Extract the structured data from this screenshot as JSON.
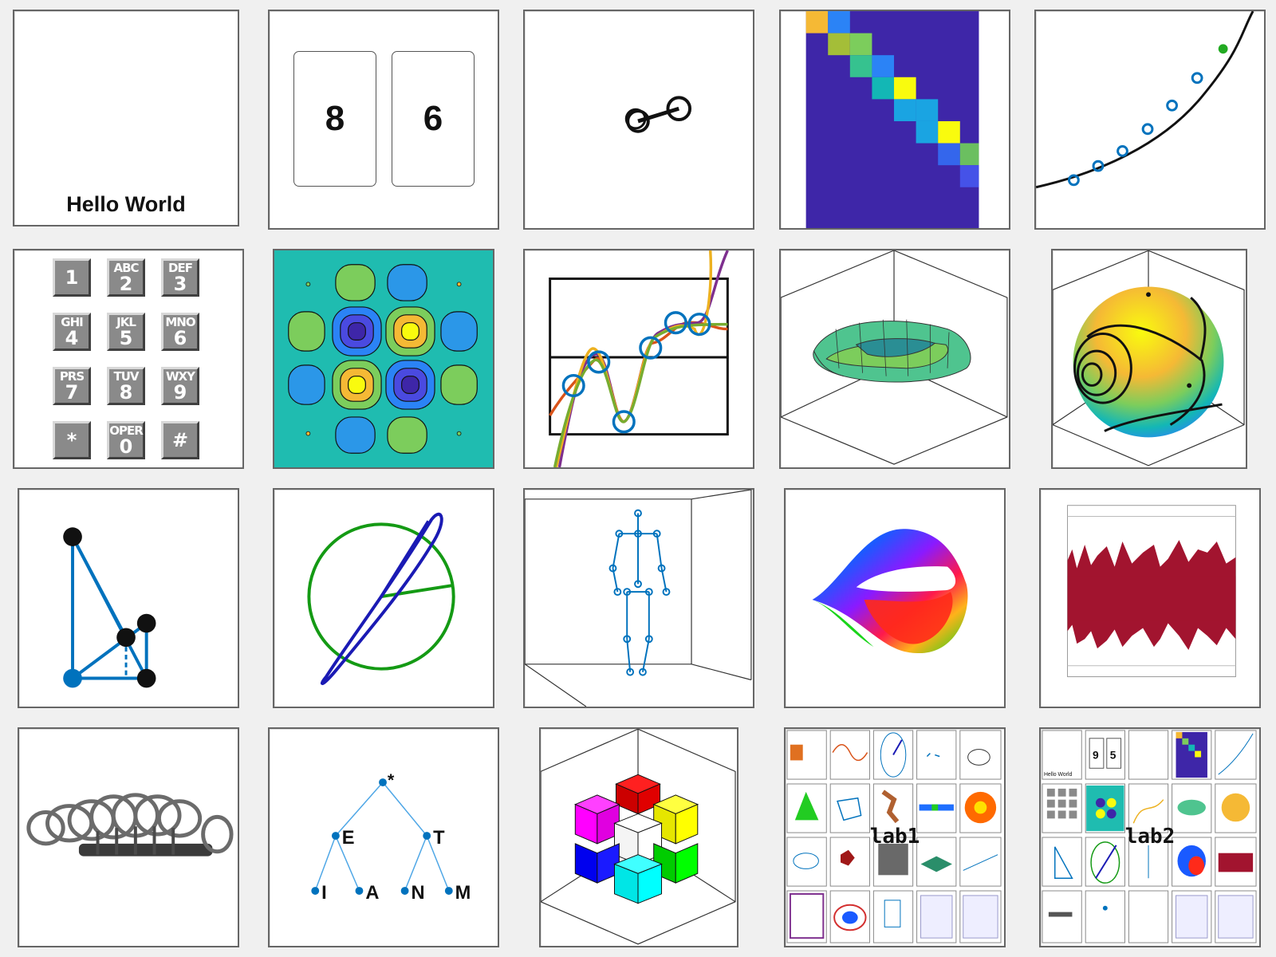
{
  "hello_world": {
    "text": "Hello World"
  },
  "cards": [
    "8",
    "6"
  ],
  "keypad": [
    {
      "sub": "",
      "main": "1"
    },
    {
      "sub": "ABC",
      "main": "2"
    },
    {
      "sub": "DEF",
      "main": "3"
    },
    {
      "sub": "GHI",
      "main": "4"
    },
    {
      "sub": "JKL",
      "main": "5"
    },
    {
      "sub": "MNO",
      "main": "6"
    },
    {
      "sub": "PRS",
      "main": "7"
    },
    {
      "sub": "TUV",
      "main": "8"
    },
    {
      "sub": "WXY",
      "main": "9"
    },
    {
      "sub": "",
      "main": "*"
    },
    {
      "sub": "OPER",
      "main": "0"
    },
    {
      "sub": "",
      "main": "#"
    }
  ],
  "morse_tree": {
    "root": "*",
    "level1": [
      "E",
      "T"
    ],
    "level2": [
      "I",
      "A",
      "N",
      "M"
    ]
  },
  "lab_thumbnails": {
    "lab1_label": "lab1",
    "lab2_label": "lab2",
    "lab2_cards": [
      "9",
      "5"
    ],
    "lab2_hello": "Hello World"
  },
  "colors": {
    "background": "#f0f0f0",
    "tile_border": "#666666",
    "parula_blue": "#3e26a8",
    "parula_yellow": "#f9fb0e",
    "plot_blue": "#0072bd",
    "plot_orange": "#d95319",
    "plot_yellow": "#edb120",
    "plot_purple": "#7e2f8e",
    "plot_green": "#77ac30",
    "audio_red": "#a2142f"
  }
}
